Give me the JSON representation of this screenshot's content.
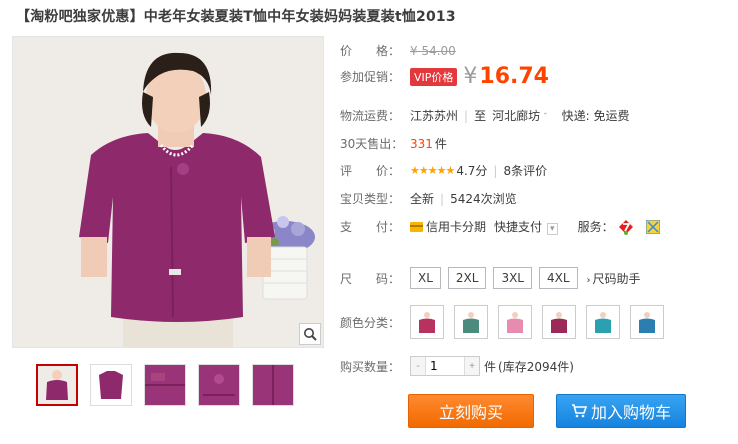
{
  "title": "【淘粉吧独家优惠】中老年女装夏装T恤中年女装妈妈装夏装t恤2013",
  "price": {
    "label": "价　　格：",
    "original": "¥ 54.00",
    "promo_label": "参加促销：",
    "vip_tag": "VIP价格",
    "yen": "¥",
    "current": "16.74"
  },
  "shipping": {
    "label": "物流运费：",
    "from": "江苏苏州",
    "to_prefix": "至",
    "to": "河北廊坊",
    "express": "快递: 免运费"
  },
  "sales": {
    "label": "30天售出：",
    "count": "331",
    "unit": "件"
  },
  "rating": {
    "label": "评　　价：",
    "stars": "★★★★★",
    "score": "4.7分",
    "reviews": "8条评价"
  },
  "type": {
    "label": "宝贝类型：",
    "condition": "全新",
    "views": "5424次浏览"
  },
  "payment": {
    "label": "支　　付：",
    "credit": "信用卡分期",
    "quick": "快捷支付",
    "service_label": "服务："
  },
  "size": {
    "label": "尺　　码：",
    "options": [
      "XL",
      "2XL",
      "3XL",
      "4XL"
    ],
    "help": "尺码助手"
  },
  "color": {
    "label": "颜色分类："
  },
  "quantity": {
    "label": "购买数量：",
    "value": "1",
    "unit": "件",
    "stock": "(库存2094件)"
  },
  "buttons": {
    "buy": "立刻购买",
    "cart": "加入购物车"
  },
  "colors": {
    "price": "#ff4400",
    "swatches": [
      "#b8325f",
      "#4d8a7e",
      "#e88bb0",
      "#9a2a5a",
      "#2aa0b0",
      "#2b7fb0"
    ]
  }
}
